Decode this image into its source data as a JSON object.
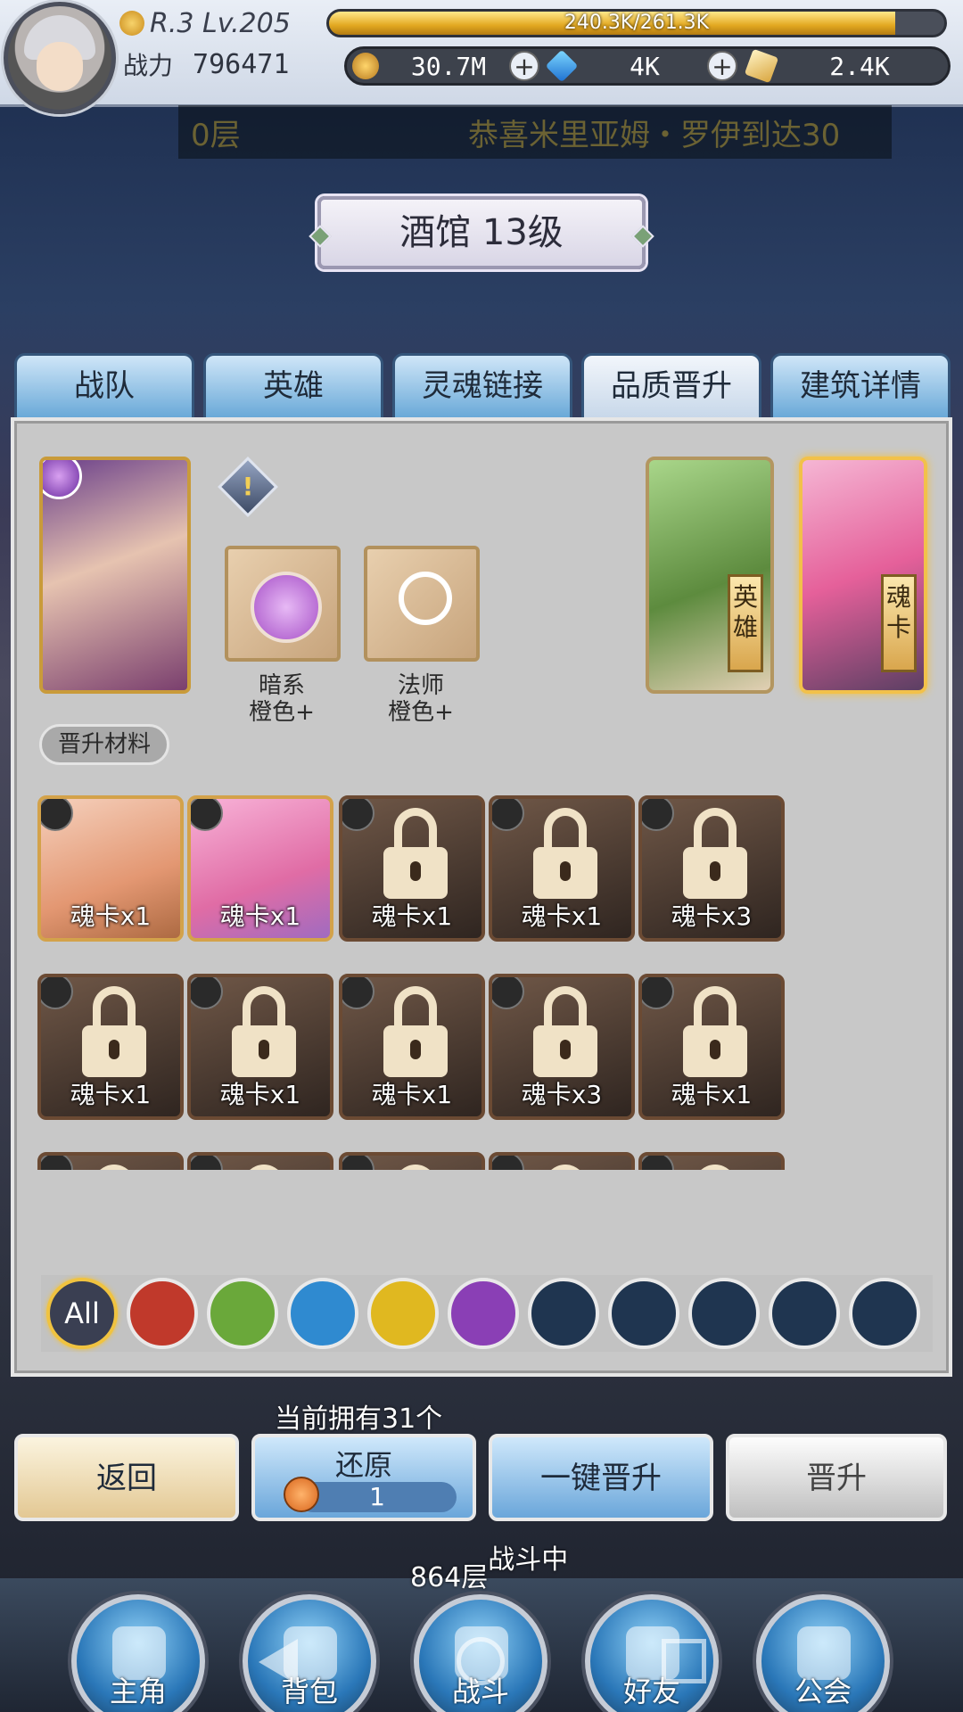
{
  "topbar": {
    "rank": "R.3 Lv.205",
    "exp_text": "240.3K/261.3K",
    "exp_progress": 0.92,
    "power_label": "战力",
    "power_value": "796471",
    "currencies": [
      {
        "icon": "gold-coin-icon",
        "value": "30.7M"
      },
      {
        "icon": "diamond-gem-icon",
        "value": "4K"
      },
      {
        "icon": "soul-crystal-icon",
        "value": "2.4K"
      }
    ],
    "plus": "+"
  },
  "notice": {
    "floor": "0层",
    "message": "恭喜米里亚姆・罗伊到达30"
  },
  "banner": {
    "title": "酒馆 13级"
  },
  "tabs": [
    {
      "label": "战队"
    },
    {
      "label": "英雄"
    },
    {
      "label": "灵魂链接"
    },
    {
      "label": "品质晋升"
    },
    {
      "label": "建筑详情"
    }
  ],
  "requirements": {
    "hint_mark": "!",
    "items": [
      {
        "line1": "暗系",
        "line2": "橙色+"
      },
      {
        "line1": "法师",
        "line2": "橙色+"
      }
    ]
  },
  "targets": {
    "hero_tag": "英雄",
    "soul_tag": "魂卡"
  },
  "materials": {
    "label": "晋升材料",
    "cards": [
      {
        "count": "魂卡x1",
        "owned": true
      },
      {
        "count": "魂卡x1",
        "owned": true
      },
      {
        "count": "魂卡x1",
        "owned": false
      },
      {
        "count": "魂卡x1",
        "owned": false
      },
      {
        "count": "魂卡x3",
        "owned": false
      },
      {
        "count": "魂卡x1",
        "owned": false
      },
      {
        "count": "魂卡x1",
        "owned": false
      },
      {
        "count": "魂卡x1",
        "owned": false
      },
      {
        "count": "魂卡x3",
        "owned": false
      },
      {
        "count": "魂卡x1",
        "owned": false
      },
      {
        "count": "",
        "owned": false
      },
      {
        "count": "",
        "owned": false
      },
      {
        "count": "",
        "owned": false
      },
      {
        "count": "",
        "owned": false
      },
      {
        "count": "",
        "owned": false
      }
    ]
  },
  "filters": {
    "all_label": "All",
    "colors": [
      "#3a3f52",
      "#c0392b",
      "#6aa83a",
      "#2f8ad0",
      "#e0b820",
      "#8a3fb5",
      "#1f3550",
      "#1f3550",
      "#1f3550",
      "#1f3550",
      "#1f3550"
    ]
  },
  "owned_text": "当前拥有31个",
  "actions": {
    "back": "返回",
    "restore": "还原",
    "restore_count": "1",
    "auto_upgrade": "一键晋升",
    "upgrade": "晋升"
  },
  "floor_status": {
    "part1": "864层",
    "part2": "战斗中"
  },
  "bottom_nav": [
    {
      "label": "主角",
      "icon": "helmet-icon"
    },
    {
      "label": "背包",
      "icon": "scroll-icon"
    },
    {
      "label": "战斗",
      "icon": "crossed-swords-icon"
    },
    {
      "label": "好友",
      "icon": "handshake-icon"
    },
    {
      "label": "公会",
      "icon": "guild-crest-icon"
    }
  ]
}
